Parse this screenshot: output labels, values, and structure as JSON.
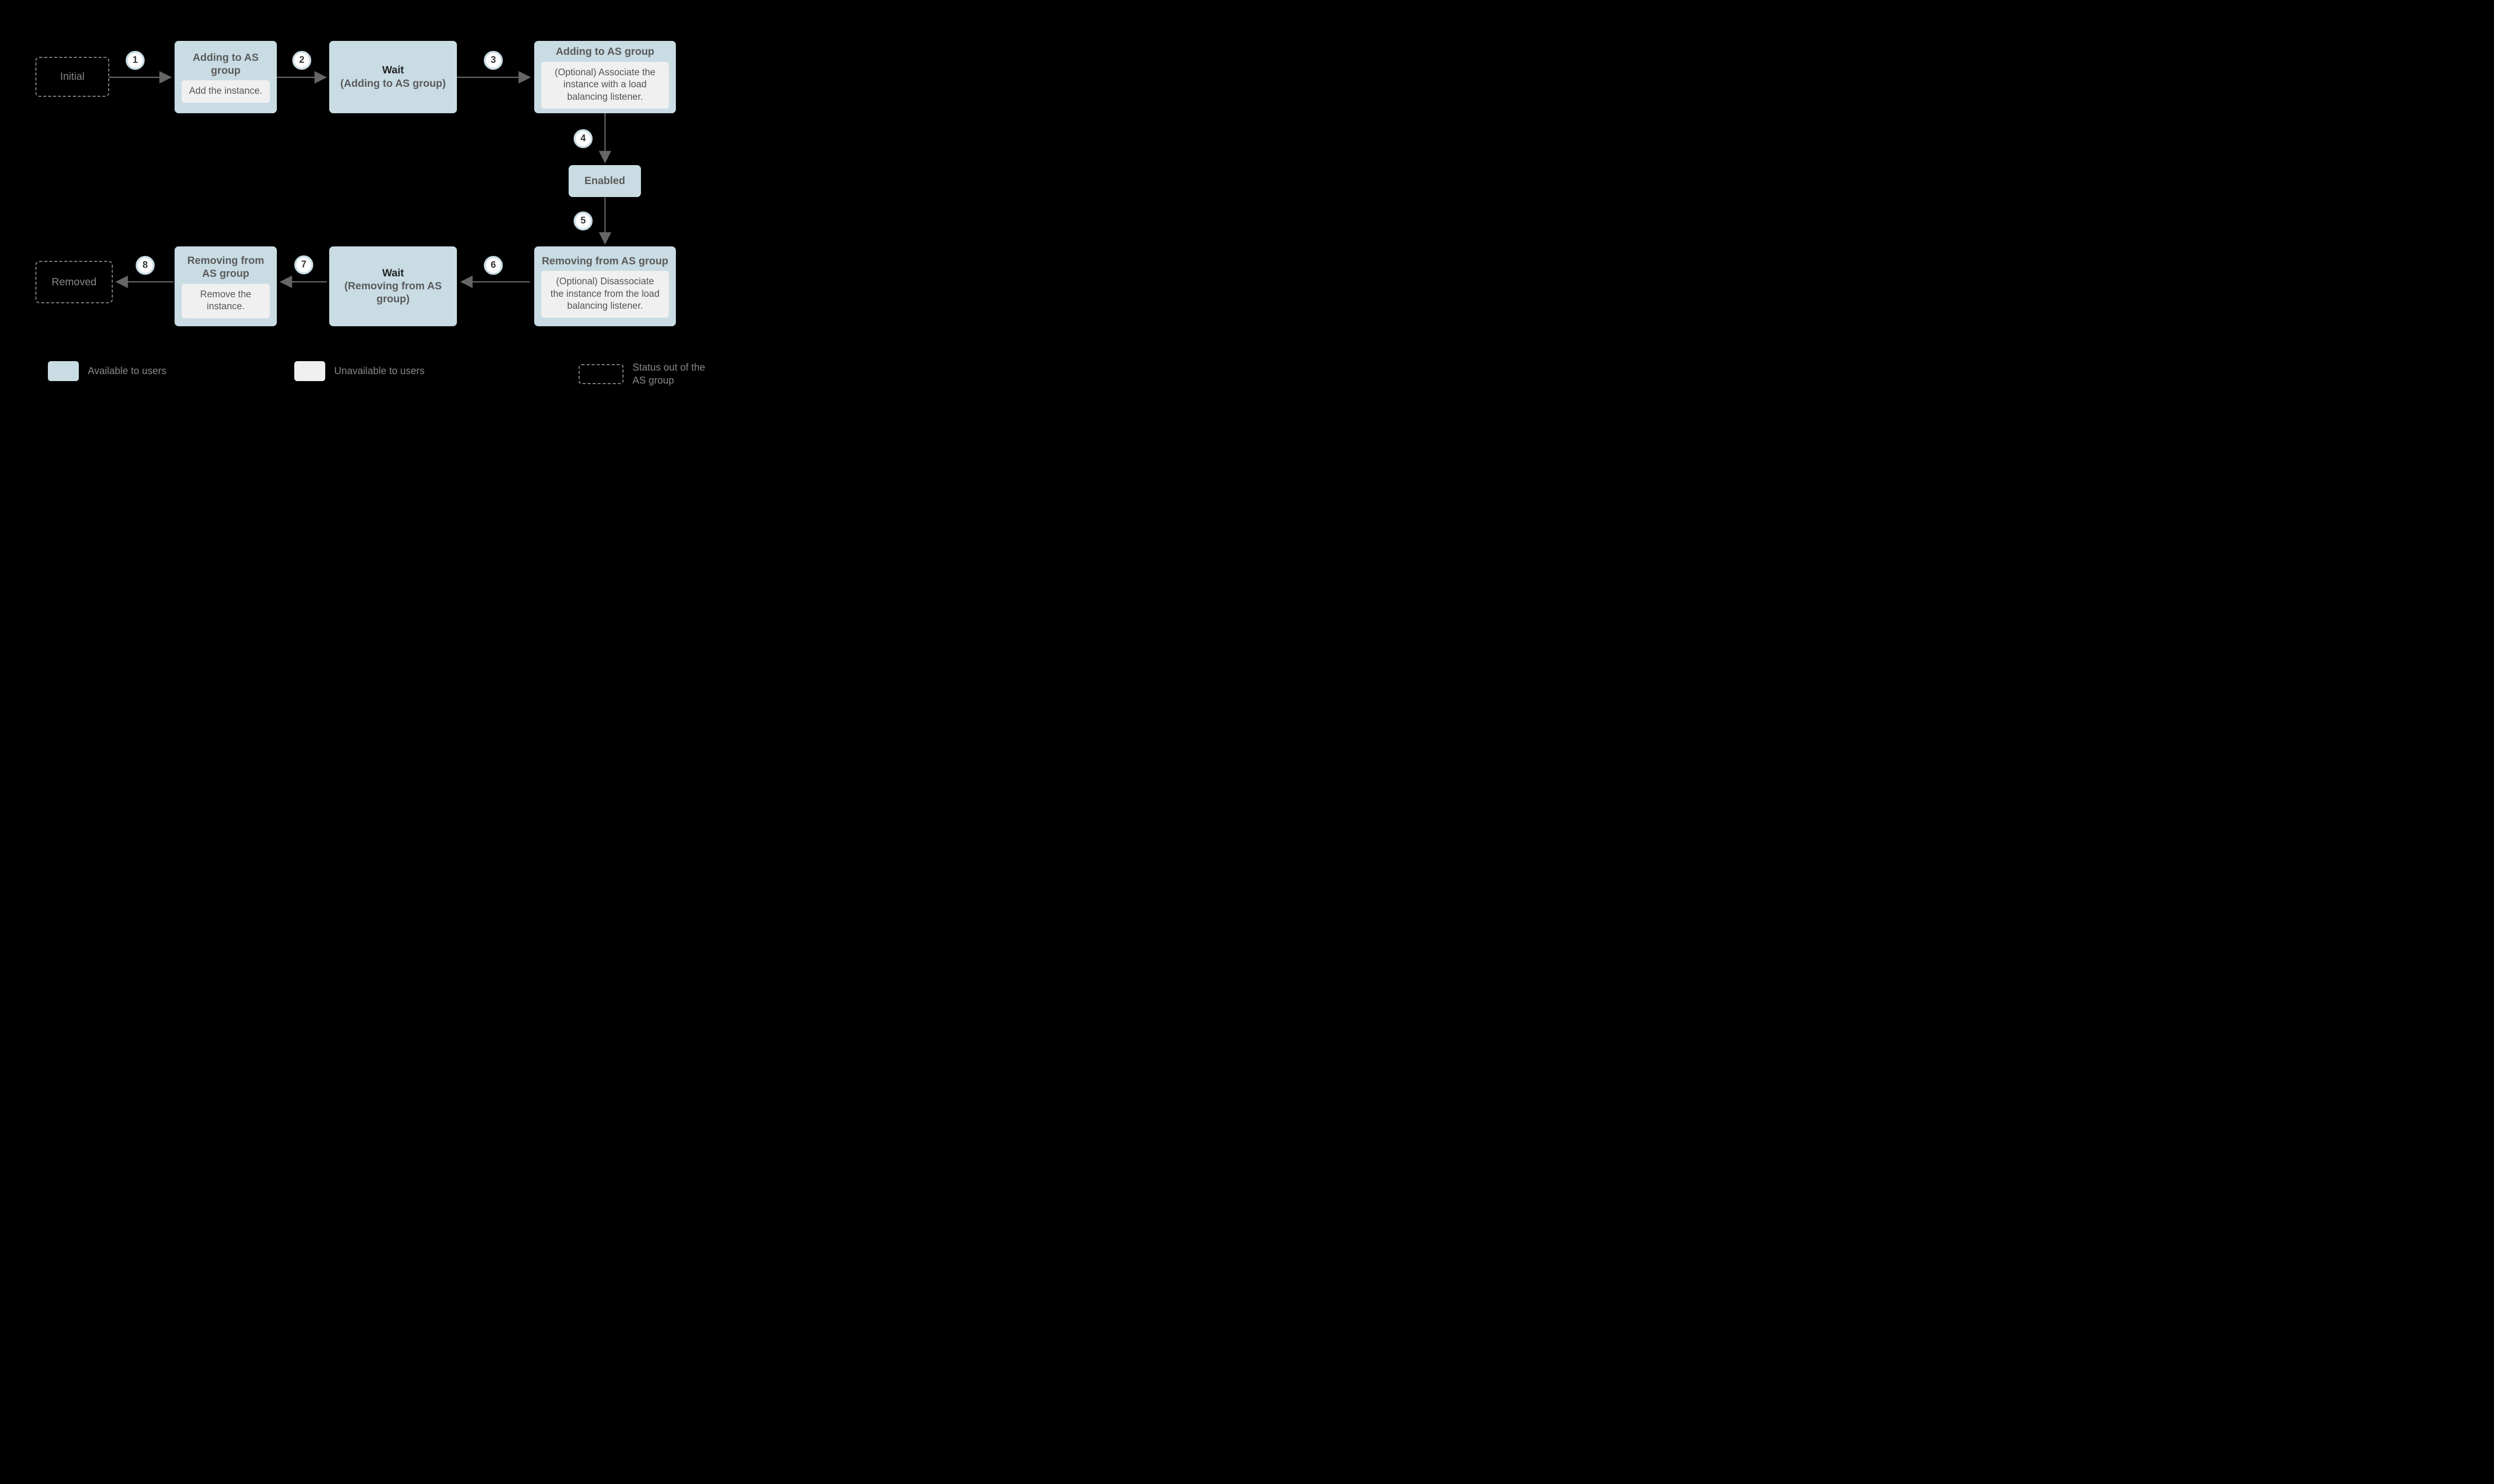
{
  "nodes": {
    "initial": {
      "label": "Initial"
    },
    "add1": {
      "title": "Adding to AS group",
      "inner": "Add the instance."
    },
    "wait1": {
      "line1": "Wait",
      "line2": "(Adding to AS group)"
    },
    "add2": {
      "title": "Adding to AS group",
      "inner": "(Optional) Associate the instance with a load balancing listener."
    },
    "enabled": {
      "label": "Enabled"
    },
    "rem1": {
      "title": "Removing from AS group",
      "inner": "(Optional) Disassociate the instance from the load balancing listener."
    },
    "wait2": {
      "line1": "Wait",
      "line2": "(Removing from AS group)"
    },
    "rem2": {
      "title": "Removing from AS group",
      "inner": "Remove the instance."
    },
    "removed": {
      "label": "Removed"
    }
  },
  "steps": {
    "s1": "1",
    "s2": "2",
    "s3": "3",
    "s4": "4",
    "s5": "5",
    "s6": "6",
    "s7": "7",
    "s8": "8"
  },
  "legend": {
    "available": "Available to users",
    "unavailable": "Unavailable to users",
    "out": "Status out of the AS group"
  }
}
